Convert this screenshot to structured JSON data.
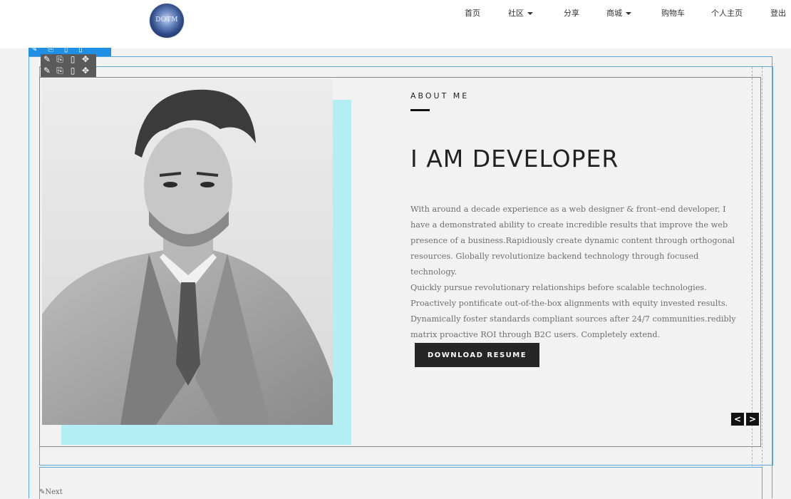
{
  "logo": {
    "text": "DOTM"
  },
  "nav": [
    {
      "label": "首页",
      "dropdown": false
    },
    {
      "label": "社区",
      "dropdown": true
    },
    {
      "label": "分享",
      "dropdown": false
    },
    {
      "label": "商城",
      "dropdown": true
    },
    {
      "label": "购物车",
      "dropdown": false
    },
    {
      "label": "个人主页",
      "dropdown": false
    },
    {
      "label": "登出",
      "dropdown": false
    }
  ],
  "editor_toolbar": {
    "icons": [
      "pencil-icon",
      "copy-icon",
      "trash-icon",
      "move-icon"
    ]
  },
  "about": {
    "kicker": "ABOUT ME",
    "headline": "I AM DEVELOPER",
    "paragraphs": [
      "With around a decade experience as a web designer & front–end developer, I have a demonstrated ability to create incredible results that improve the web presence of a business.Rapidiously create dynamic content through orthogonal resources. Globally revolutionize backend technology through focused technology.",
      "Quickly pursue revolutionary relationships before scalable technologies. Proactively pontificate out-of-the-box alignments with equity invested results. Dynamically foster standards compliant sources after 24/7 communities.redibly matrix proactive ROI through B2C users. Completely extend."
    ],
    "cta": "DOWNLOAD RESUME"
  },
  "slider": {
    "prev": "<",
    "next": ">"
  },
  "footer": {
    "next_link": "Next"
  },
  "colors": {
    "accent_cyan": "#b3eef5",
    "edit_blue": "#1e8fe3",
    "dark": "#262626"
  }
}
